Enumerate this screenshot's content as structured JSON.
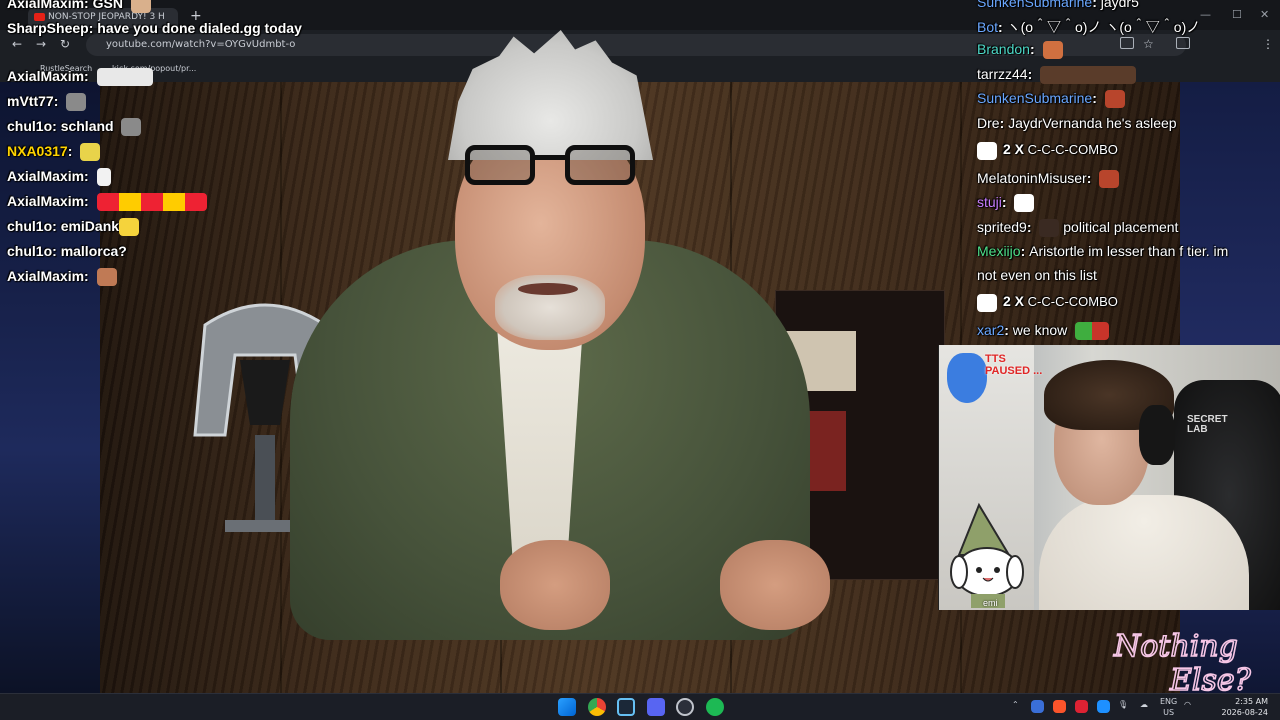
{
  "browser": {
    "tab_title": "NON-STOP JEOPARDY! 3 H",
    "url": "youtube.com/watch?v=OYGvUdmbt-o",
    "bookmarks": [
      "RustleSearch",
      "kick.com/popout/pr..."
    ]
  },
  "chat_left": [
    {
      "user": "AxialMaxim",
      "color": "#ffffff",
      "text": "GSN"
    },
    {
      "user": "SharpSheep",
      "color": "#ffffff",
      "text": "have you done dialed.gg today"
    },
    {
      "user": "AxialMaxim",
      "color": "#ffffff",
      "text": ""
    },
    {
      "user": "mVtt77",
      "color": "#ffffff",
      "text": ""
    },
    {
      "user": "chul1o",
      "color": "#ffffff",
      "text": "schland"
    },
    {
      "user": "NXA0317",
      "color": "#ffd400",
      "text": ""
    },
    {
      "user": "AxialMaxim",
      "color": "#ffffff",
      "text": ""
    },
    {
      "user": "AxialMaxim",
      "color": "#ffffff",
      "text": ""
    },
    {
      "user": "chul1o",
      "color": "#ffffff",
      "text": "emiDank"
    },
    {
      "user": "chul1o",
      "color": "#ffffff",
      "text": "mallorca?"
    },
    {
      "user": "AxialMaxim",
      "color": "#ffffff",
      "text": ""
    }
  ],
  "chat_right": [
    {
      "user": "SunkenSubmarine",
      "color": "#6aa7ff",
      "text": "jaydr5"
    },
    {
      "user": "Bot",
      "color": "#6aa7ff",
      "text": "ヽ(o＾▽＾o)ノ  ヽ(o＾▽＾o)ノ"
    },
    {
      "user": "Brandon",
      "color": "#4dd9c8",
      "text": ""
    },
    {
      "user": "tarrzz44",
      "color": "#ffffff",
      "text": ""
    },
    {
      "user": "SunkenSubmarine",
      "color": "#6aa7ff",
      "text": ""
    },
    {
      "user": "Dre",
      "color": "#ffffff",
      "text": "JaydrVernanda he's asleep"
    },
    {
      "combo": "2 X",
      "combo_text": "C-C-C-COMBO"
    },
    {
      "user": "MelatoninMisuser",
      "color": "#ffffff",
      "text": ""
    },
    {
      "user": "stuji",
      "color": "#c77dff",
      "text": ""
    },
    {
      "user": "sprited9",
      "color": "#ffffff",
      "text": "political placement"
    },
    {
      "user": "Mexiijo",
      "color": "#4ee08a",
      "text": "Aristortle im lesser than f tier. im"
    },
    {
      "user": "",
      "color": "#ffffff",
      "text": "not even on this list"
    },
    {
      "combo": "2 X",
      "combo_text": "C-C-C-COMBO"
    },
    {
      "user": "xar2",
      "color": "#6aa7ff",
      "text": "we know"
    }
  ],
  "webcam": {
    "tts_status": "TTS PAUSED ...",
    "mascot_label": "emi",
    "chair_brand": "SECRET LAB"
  },
  "logo_text": "Nothing Else?",
  "taskbar": {
    "lang": "ENG",
    "region": "US",
    "time": "2:35 AM",
    "date": "2026-08-24"
  }
}
